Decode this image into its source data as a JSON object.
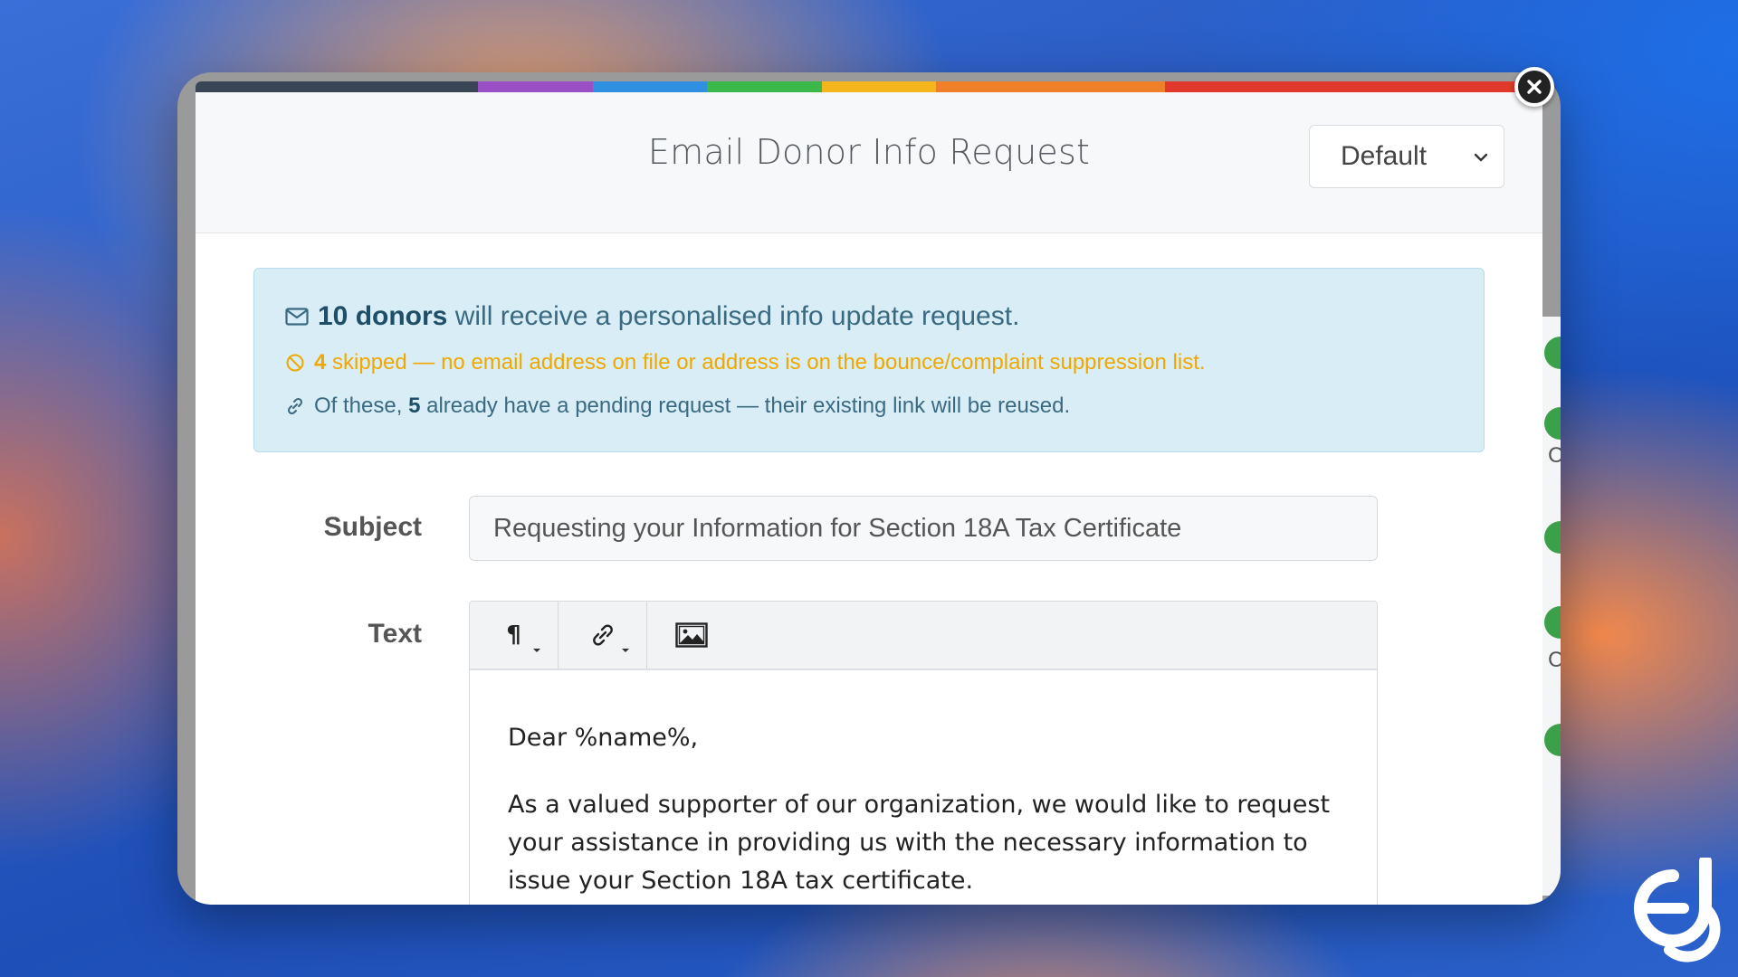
{
  "dialog": {
    "title": "Email Donor Info Request",
    "template_select": {
      "selected": "Default"
    },
    "color_strip": [
      "#3a4656",
      "#9b4fc4",
      "#2f8fe0",
      "#3cb84a",
      "#f5b51c",
      "#f07f2a",
      "#e0392b"
    ]
  },
  "alert": {
    "line1": {
      "count": "10 donors",
      "text": " will receive a personalised info update request."
    },
    "line2": {
      "count": "4",
      "text": " skipped — no email address on file or address is on the bounce/complaint suppression list."
    },
    "line3": {
      "prefix": "Of these, ",
      "count": "5",
      "text": " already have a pending request — their existing link will be reused."
    }
  },
  "form": {
    "subject_label": "Subject",
    "subject_value": "Requesting your Information for Section 18A Tax Certificate",
    "text_label": "Text",
    "toolbar": {
      "paragraph_icon": "pilcrow-icon",
      "link_icon": "link-icon",
      "image_icon": "image-icon"
    },
    "body": {
      "greeting": "Dear %name%,",
      "paragraph1": "As a valued supporter of our organization, we would like to request your assistance in providing us with the necessary information to issue your Section 18A tax certificate."
    }
  },
  "background_app": {
    "letters": [
      "C",
      "C"
    ]
  },
  "icons": {
    "close": "close-icon",
    "brand": "brand-logo",
    "mail": "mail-icon",
    "blocked": "blocked-icon",
    "link": "link-icon"
  },
  "colors": {
    "info_bg": "#d8edf5",
    "warning": "#f0a800",
    "info_text": "#3a6a82"
  }
}
